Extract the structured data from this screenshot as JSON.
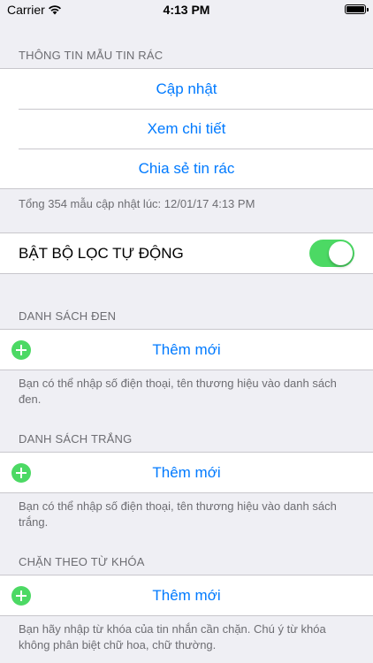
{
  "status_bar": {
    "carrier": "Carrier",
    "time": "4:13 PM",
    "battery_level": 1.0
  },
  "spam_samples": {
    "header": "THÔNG TIN MẪU TIN RÁC",
    "actions": [
      "Cập nhật",
      "Xem chi tiết",
      "Chia sẻ tin rác"
    ],
    "footer": "Tổng 354 mẫu cập nhật lúc: 12/01/17 4:13 PM"
  },
  "auto_filter": {
    "label": "BẬT BỘ LỌC TỰ ĐỘNG",
    "enabled": true
  },
  "blacklist": {
    "header": "DANH SÁCH ĐEN",
    "add_label": "Thêm mới",
    "footer": "Bạn có thể nhập số điện thoại, tên thương hiệu vào danh sách đen."
  },
  "whitelist": {
    "header": "DANH SÁCH TRẮNG",
    "add_label": "Thêm mới",
    "footer": "Bạn có thể nhập số điện thoại, tên thương hiệu vào danh sách trắng."
  },
  "keyword_block": {
    "header": "CHẶN THEO TỪ KHÓA",
    "add_label": "Thêm mới",
    "footer": "Bạn hãy nhập từ khóa của tin nhắn cần chặn. Chú ý từ khóa không phân biệt chữ hoa, chữ thường."
  },
  "colors": {
    "accent": "#007aff",
    "toggle_on": "#4cd964",
    "add_icon": "#4cd964",
    "background": "#efeff4"
  }
}
